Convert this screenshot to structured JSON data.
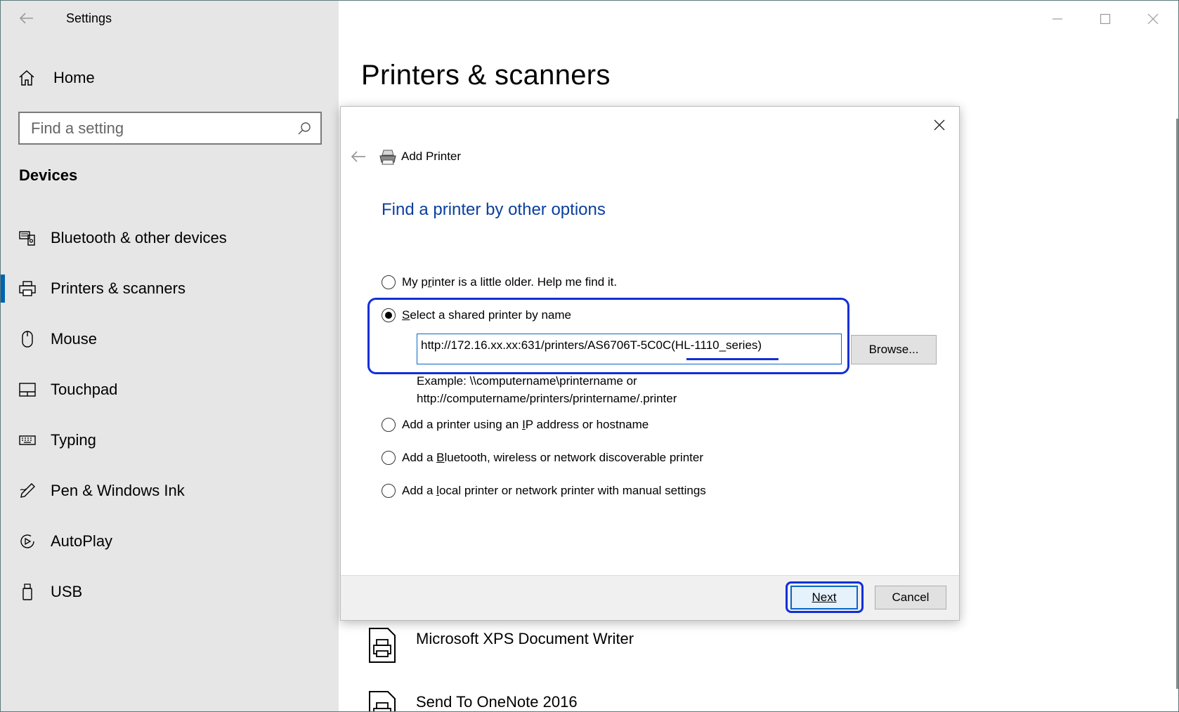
{
  "window": {
    "title": "Settings"
  },
  "sidebar": {
    "home_label": "Home",
    "search_placeholder": "Find a setting",
    "section_heading": "Devices",
    "items": [
      {
        "label": "Bluetooth & other devices",
        "icon": "bluetooth-devices-icon"
      },
      {
        "label": "Printers & scanners",
        "icon": "printer-icon",
        "selected": true
      },
      {
        "label": "Mouse",
        "icon": "mouse-icon"
      },
      {
        "label": "Touchpad",
        "icon": "touchpad-icon"
      },
      {
        "label": "Typing",
        "icon": "keyboard-icon"
      },
      {
        "label": "Pen & Windows Ink",
        "icon": "pen-icon"
      },
      {
        "label": "AutoPlay",
        "icon": "autoplay-icon"
      },
      {
        "label": "USB",
        "icon": "usb-icon"
      }
    ]
  },
  "main": {
    "page_title": "Printers & scanners",
    "printers": [
      {
        "name": "Microsoft XPS Document Writer"
      },
      {
        "name": "Send To OneNote 2016"
      }
    ]
  },
  "dialog": {
    "title": "Add Printer",
    "heading": "Find a printer by other options",
    "options": [
      {
        "pre": "My p",
        "ul": "r",
        "post": "inter is a little older. Help me find it.",
        "selected": false
      },
      {
        "pre": "",
        "ul": "S",
        "post": "elect a shared printer by name",
        "selected": true
      },
      {
        "pre": "Add a printer using an ",
        "ul": "I",
        "post": "P address or hostname",
        "selected": false
      },
      {
        "pre": "Add a ",
        "ul": "B",
        "post": "luetooth, wireless or network discoverable printer",
        "selected": false
      },
      {
        "pre": "Add a ",
        "ul": "l",
        "post": "ocal printer or network printer with manual settings",
        "selected": false
      }
    ],
    "url_value": "http://172.16.xx.xx:631/printers/AS6706T-5C0C(HL-1110_series)",
    "browse_label": "Browse...",
    "example_line1": "Example: \\\\computername\\printername or",
    "example_line2": "http://computername/printers/printername/.printer",
    "next_label": "Next",
    "cancel_label": "Cancel"
  },
  "colors": {
    "accent": "#0063b1",
    "heading_blue": "#0b3f9e",
    "annotation_blue": "#1030d8",
    "sidebar_bg": "#e6e6e6"
  }
}
